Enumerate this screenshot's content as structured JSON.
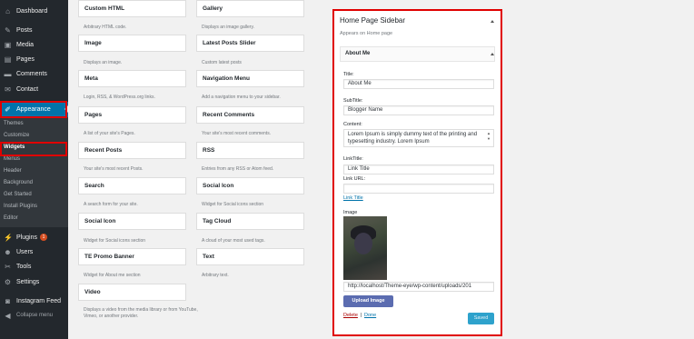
{
  "admin_menu": {
    "items": [
      {
        "label": "Dashboard",
        "icon": "dashboard-icon",
        "glyph": "⌂"
      },
      {
        "label": "Posts",
        "icon": "pin-icon",
        "glyph": "✎"
      },
      {
        "label": "Media",
        "icon": "media-icon",
        "glyph": "▣"
      },
      {
        "label": "Pages",
        "icon": "pages-icon",
        "glyph": "▤"
      },
      {
        "label": "Comments",
        "icon": "comment-icon",
        "glyph": "▬"
      },
      {
        "label": "Contact",
        "icon": "mail-icon",
        "glyph": "✉"
      },
      {
        "label": "Appearance",
        "icon": "brush-icon",
        "glyph": "✐"
      },
      {
        "label": "Plugins",
        "icon": "plugin-icon",
        "glyph": "⚡",
        "badge": "1"
      },
      {
        "label": "Users",
        "icon": "users-icon",
        "glyph": "☻"
      },
      {
        "label": "Tools",
        "icon": "wrench-icon",
        "glyph": "✂"
      },
      {
        "label": "Settings",
        "icon": "settings-icon",
        "glyph": "⚙"
      },
      {
        "label": "Instagram Feed",
        "icon": "instagram-icon",
        "glyph": "◙"
      },
      {
        "label": "Collapse menu",
        "icon": "collapse-icon",
        "glyph": "◀"
      }
    ],
    "appearance_submenu": [
      "Themes",
      "Customize",
      "Widgets",
      "Menus",
      "Header",
      "Background",
      "Get Started",
      "Install Plugins",
      "Editor"
    ]
  },
  "available_widgets": [
    {
      "title": "Custom HTML",
      "desc": "Arbitrary HTML code."
    },
    {
      "title": "Gallery",
      "desc": "Displays an image gallery."
    },
    {
      "title": "Image",
      "desc": "Displays an image."
    },
    {
      "title": "Latest Posts Slider",
      "desc": "Custom latest posts"
    },
    {
      "title": "Meta",
      "desc": "Login, RSS, & WordPress.org links."
    },
    {
      "title": "Navigation Menu",
      "desc": "Add a navigation menu to your sidebar."
    },
    {
      "title": "Pages",
      "desc": "A list of your site's Pages."
    },
    {
      "title": "Recent Comments",
      "desc": "Your site's most recent comments."
    },
    {
      "title": "Recent Posts",
      "desc": "Your site's most recent Posts."
    },
    {
      "title": "RSS",
      "desc": "Entries from any RSS or Atom feed."
    },
    {
      "title": "Search",
      "desc": "A search form for your site."
    },
    {
      "title": "Social Icon",
      "desc": "Widget for Social icons section"
    },
    {
      "title": "Social Icon",
      "desc": "Widget for Social icons section"
    },
    {
      "title": "Tag Cloud",
      "desc": "A cloud of your most used tags."
    },
    {
      "title": "TE Promo Banner",
      "desc": "Widget for About me section"
    },
    {
      "title": "Text",
      "desc": "Arbitrary text."
    },
    {
      "title": "Video",
      "desc": "Displays a video from the media library or from YouTube, Vimeo, or another provider."
    }
  ],
  "widget_area": {
    "title": "Home Page Sidebar",
    "description": "Appears on Home page",
    "widget": {
      "title": "About Me",
      "title_label": "Title:",
      "title_value": "About Me",
      "subtitle_label": "SubTitle:",
      "subtitle_value": "Blogger Name",
      "content_label": "Content:",
      "content_value": "Lorem Ipsum is simply dummy text of the printing and typesetting industry. Lorem Ipsum",
      "linktitle_label": "LinkTitle:",
      "linktitle_value": "Link Title",
      "linkurl_label": "Link URL:",
      "linkurl_value": "",
      "link_preview": "Link Title",
      "image_label": "Image",
      "image_url": "http://localhost/Theme-eye/wp-content/uploads/201",
      "upload_label": "Upload Image",
      "delete_label": "Delete",
      "separator": "|",
      "done_label": "Done",
      "saved_label": "Saved"
    }
  },
  "colors": {
    "sidebar_bg": "#23282d",
    "active_bg": "#0073aa",
    "highlight_border": "#e00000",
    "link": "#0073aa",
    "upload_button": "#5b6cb0",
    "saved_button": "#2ea2cc"
  }
}
